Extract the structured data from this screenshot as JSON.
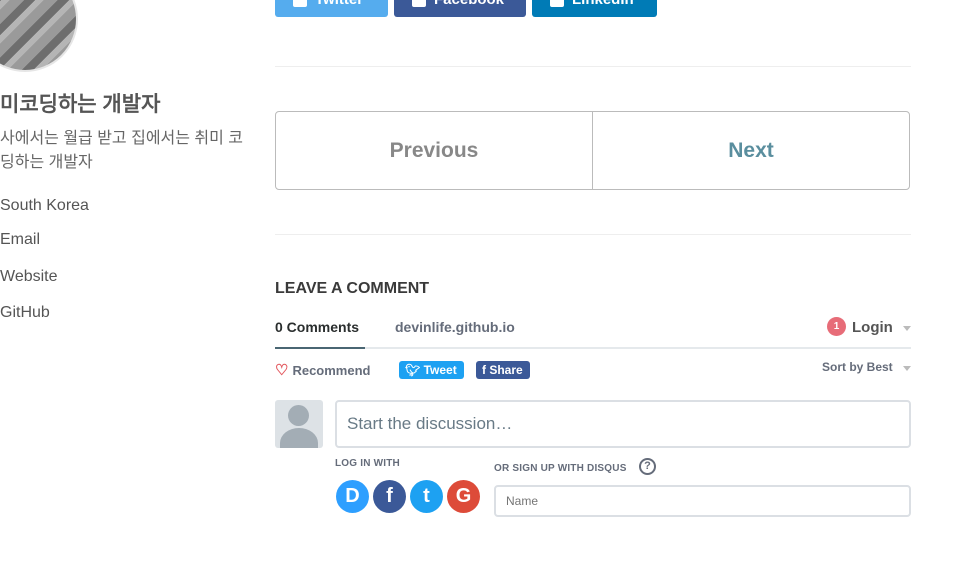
{
  "sidebar": {
    "name": "미코딩하는 개발자",
    "bio": "사에서는 월급 받고 집에서는 취미 코딩하는 개발자",
    "links": [
      {
        "label": "South Korea",
        "icon": "map-marker-icon"
      },
      {
        "label": "Email",
        "icon": "envelope-icon"
      },
      {
        "label": "Website",
        "icon": "link-icon"
      },
      {
        "label": "GitHub",
        "icon": "github-icon"
      }
    ]
  },
  "share": {
    "buttons": [
      {
        "label": "Twitter",
        "icon": "twitter-icon",
        "color": "#55acee"
      },
      {
        "label": "Facebook",
        "icon": "facebook-icon",
        "color": "#3b5998"
      },
      {
        "label": "LinkedIn",
        "icon": "linkedin-icon",
        "color": "#007bb6"
      }
    ]
  },
  "pagination": {
    "previous": "Previous",
    "next": "Next"
  },
  "comments": {
    "title": "LEAVE A COMMENT",
    "tabs": {
      "comments": "0 Comments",
      "site": "devinlife.github.io"
    },
    "notification_count": "1",
    "login": "Login",
    "recommend": "Recommend",
    "tweet": "Tweet",
    "share": "Share",
    "sort": "Sort by Best",
    "placeholder": "Start the discussion…",
    "log_in_with": "LOG IN WITH",
    "sign_up": "OR SIGN UP WITH DISQUS",
    "help": "?",
    "name_placeholder": "Name",
    "social": [
      {
        "letter": "D",
        "icon": "disqus-icon",
        "color": "#2e9fff"
      },
      {
        "letter": "f",
        "icon": "facebook-icon",
        "color": "#3b5998"
      },
      {
        "letter": "t",
        "icon": "twitter-icon",
        "color": "#1da1f2"
      },
      {
        "letter": "G",
        "icon": "google-icon",
        "color": "#dd4b39"
      }
    ]
  }
}
